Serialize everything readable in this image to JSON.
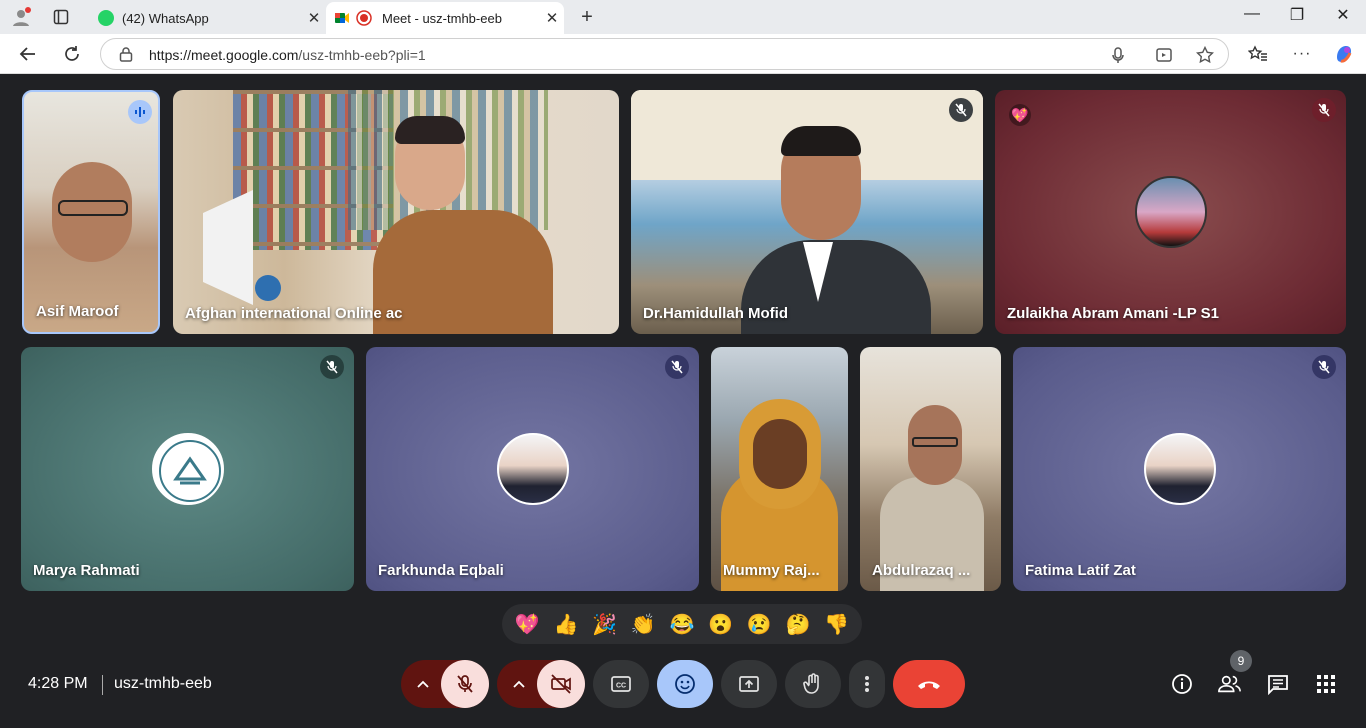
{
  "browser": {
    "tabs": [
      {
        "title": "(42) WhatsApp",
        "favicon": "whatsapp-icon",
        "active": false
      },
      {
        "title": "Meet - usz-tmhb-eeb",
        "favicon": "meet-icon",
        "active": true,
        "recording": true
      }
    ],
    "new_tab": "+",
    "url_domain": "https://meet.google.com",
    "url_path": "/usz-tmhb-eeb?pli=1"
  },
  "participants": [
    {
      "name": "Asif Maroof",
      "speaking": true
    },
    {
      "name": "Afghan international Online ac"
    },
    {
      "name": "Dr.Hamidullah Mofid",
      "muted": true
    },
    {
      "name": "Zulaikha Abram Amani -LP S1",
      "muted": true,
      "reaction": "💖"
    },
    {
      "name": "Marya Rahmati",
      "muted": true
    },
    {
      "name": "Farkhunda Eqbali",
      "muted": true
    },
    {
      "name": "Mummy Raj..."
    },
    {
      "name": "Abdulrazaq ..."
    },
    {
      "name": "Fatima Latif Zat",
      "muted": true
    }
  ],
  "reactions": [
    "💖",
    "👍",
    "🎉",
    "👏",
    "😂",
    "😮",
    "😢",
    "🤔",
    "👎"
  ],
  "bottom": {
    "time": "4:28 PM",
    "meeting_code": "usz-tmhb-eeb",
    "people_count": "9"
  },
  "colors": {
    "end_call": "#ea4335",
    "mic_off_bg": "#f9dedc",
    "emoji_active": "#a8c7fa",
    "speaking_border": "#a8c7fa"
  }
}
